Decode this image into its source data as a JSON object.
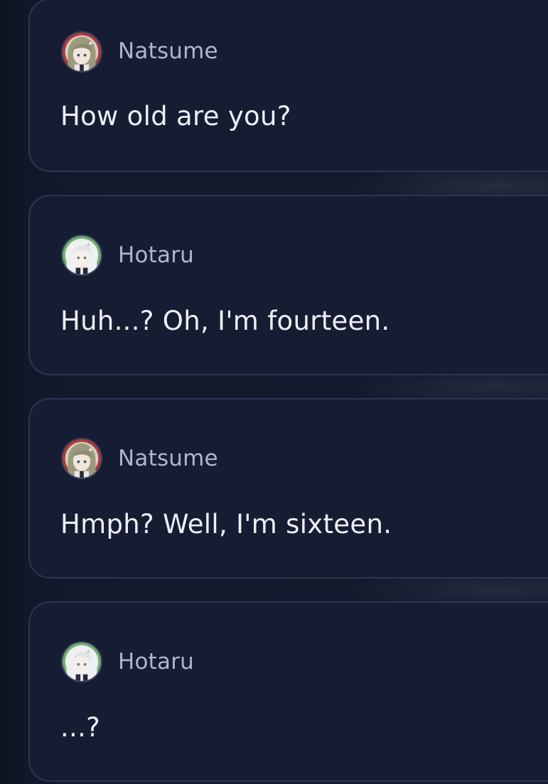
{
  "colors": {
    "background": "#111726",
    "card_background": "#161d33",
    "card_border": "#2d3550",
    "name_text": "#aeb5cf",
    "message_text": "#eef0f6"
  },
  "messages": [
    {
      "sender": "Natsume",
      "avatar_icon": "natsume-avatar-icon",
      "text": "How old are you?"
    },
    {
      "sender": "Hotaru",
      "avatar_icon": "hotaru-avatar-icon",
      "text": "Huh...? Oh, I'm fourteen."
    },
    {
      "sender": "Natsume",
      "avatar_icon": "natsume-avatar-icon",
      "text": "Hmph? Well, I'm sixteen."
    },
    {
      "sender": "Hotaru",
      "avatar_icon": "hotaru-avatar-icon",
      "text": "...?"
    }
  ]
}
